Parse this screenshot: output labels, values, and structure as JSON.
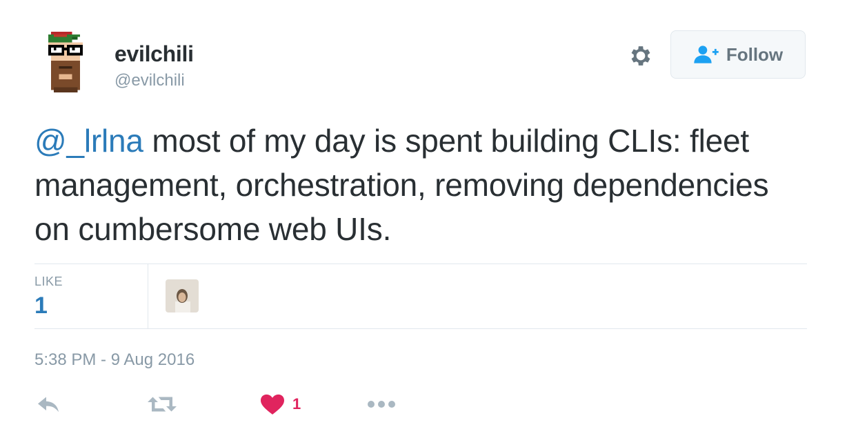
{
  "user": {
    "display_name": "evilchili",
    "handle": "@evilchili"
  },
  "follow_button": {
    "label": "Follow"
  },
  "tweet": {
    "mention": "@_lrlna",
    "text": " most of my day is spent building CLIs: fleet management, orchestration, removing dependencies on cumbersome web UIs."
  },
  "stats": {
    "likes_label": "LIKE",
    "likes_count": "1"
  },
  "timestamp": "5:38 PM - 9 Aug 2016",
  "actions": {
    "like_count": "1"
  },
  "colors": {
    "link": "#2b7bb9",
    "muted": "#8899a6",
    "text": "#292f33",
    "like": "#e0245e",
    "follow_icon": "#1da1f2"
  },
  "icons": [
    "gear-icon",
    "follow-user-icon",
    "reply-icon",
    "retweet-icon",
    "heart-icon",
    "more-icon"
  ]
}
